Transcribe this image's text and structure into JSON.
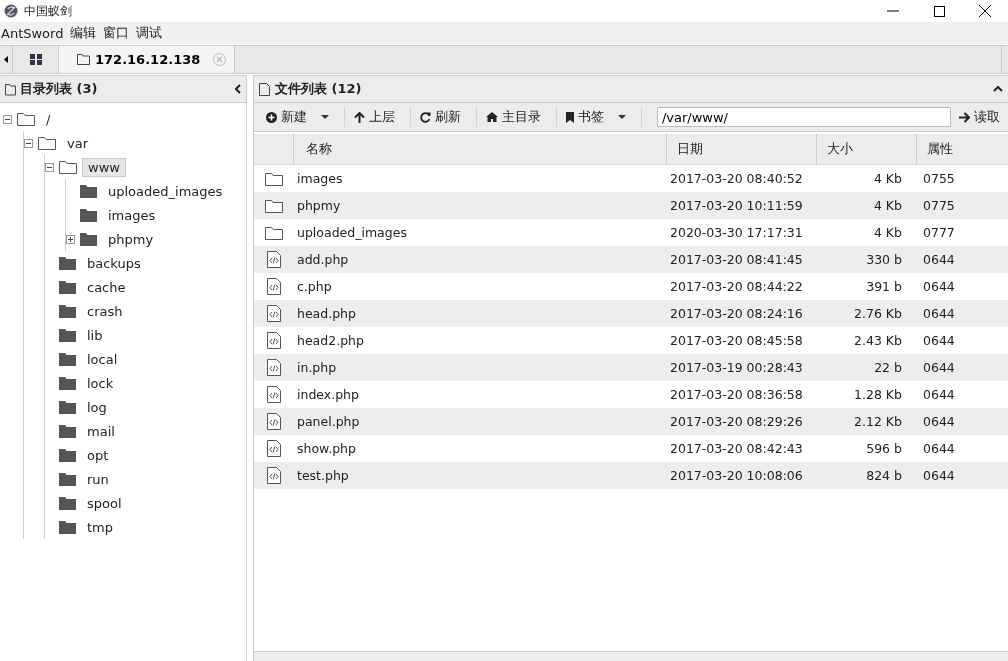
{
  "window": {
    "title": "中国蚁剑"
  },
  "menu": [
    "AntSword",
    "编辑",
    "窗口",
    "调试"
  ],
  "tabs": [
    {
      "kind": "home",
      "selected": false
    },
    {
      "kind": "folder",
      "label": "172.16.12.138",
      "selected": true
    }
  ],
  "directory_panel": {
    "title": "目录列表 (3)",
    "tree": [
      {
        "name": "/",
        "expanded": true,
        "selected": false,
        "children": [
          {
            "name": "var",
            "expanded": true,
            "selected": false,
            "children": [
              {
                "name": "www",
                "expanded": true,
                "selected": true,
                "children": [
                  {
                    "name": "uploaded_images",
                    "selected": false
                  },
                  {
                    "name": "images",
                    "selected": false
                  },
                  {
                    "name": "phpmy",
                    "expanded": false,
                    "selected": false
                  }
                ]
              },
              {
                "name": "backups",
                "selected": false
              },
              {
                "name": "cache",
                "selected": false
              },
              {
                "name": "crash",
                "selected": false
              },
              {
                "name": "lib",
                "selected": false
              },
              {
                "name": "local",
                "selected": false
              },
              {
                "name": "lock",
                "selected": false
              },
              {
                "name": "log",
                "selected": false
              },
              {
                "name": "mail",
                "selected": false
              },
              {
                "name": "opt",
                "selected": false
              },
              {
                "name": "run",
                "selected": false
              },
              {
                "name": "spool",
                "selected": false
              },
              {
                "name": "tmp",
                "selected": false
              }
            ]
          }
        ]
      }
    ]
  },
  "file_panel": {
    "title": "文件列表 (12)",
    "toolbar": [
      {
        "kind": "new",
        "label": "新建",
        "dropdown": true
      },
      {
        "kind": "up",
        "label": "上层",
        "dropdown": false
      },
      {
        "kind": "refresh",
        "label": "刷新",
        "dropdown": false
      },
      {
        "kind": "home",
        "label": "主目录",
        "dropdown": false
      },
      {
        "kind": "bookmark",
        "label": "书签",
        "dropdown": true
      }
    ],
    "path": "/var/www/",
    "read_button": "读取",
    "columns": [
      "名称",
      "日期",
      "大小",
      "属性"
    ],
    "rows": [
      {
        "kind": "folder",
        "name": "images",
        "date": "2017-03-20 08:40:52",
        "size": "4 Kb",
        "perm": "0755"
      },
      {
        "kind": "folder",
        "name": "phpmy",
        "date": "2017-03-20 10:11:59",
        "size": "4 Kb",
        "perm": "0775"
      },
      {
        "kind": "folder",
        "name": "uploaded_images",
        "date": "2020-03-30 17:17:31",
        "size": "4 Kb",
        "perm": "0777"
      },
      {
        "kind": "file",
        "name": "add.php",
        "date": "2017-03-20 08:41:45",
        "size": "330 b",
        "perm": "0644"
      },
      {
        "kind": "file",
        "name": "c.php",
        "date": "2017-03-20 08:44:22",
        "size": "391 b",
        "perm": "0644"
      },
      {
        "kind": "file",
        "name": "head.php",
        "date": "2017-03-20 08:24:16",
        "size": "2.76 Kb",
        "perm": "0644"
      },
      {
        "kind": "file",
        "name": "head2.php",
        "date": "2017-03-20 08:45:58",
        "size": "2.43 Kb",
        "perm": "0644"
      },
      {
        "kind": "file",
        "name": "in.php",
        "date": "2017-03-19 00:28:43",
        "size": "22 b",
        "perm": "0644"
      },
      {
        "kind": "file",
        "name": "index.php",
        "date": "2017-03-20 08:36:58",
        "size": "1.28 Kb",
        "perm": "0644"
      },
      {
        "kind": "file",
        "name": "panel.php",
        "date": "2017-03-20 08:29:26",
        "size": "2.12 Kb",
        "perm": "0644"
      },
      {
        "kind": "file",
        "name": "show.php",
        "date": "2017-03-20 08:42:43",
        "size": "596 b",
        "perm": "0644"
      },
      {
        "kind": "file",
        "name": "test.php",
        "date": "2017-03-20 10:08:06",
        "size": "824 b",
        "perm": "0644"
      }
    ]
  }
}
